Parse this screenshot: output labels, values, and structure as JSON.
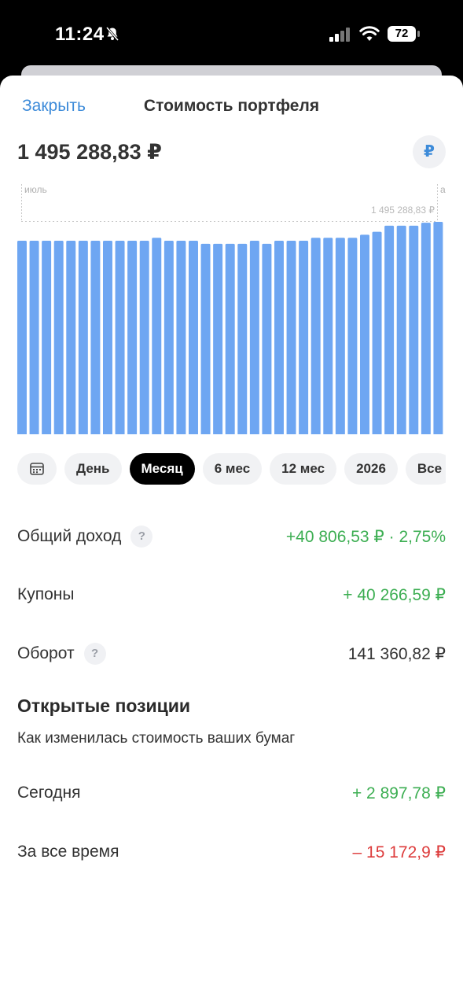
{
  "status_bar": {
    "time": "11:24",
    "battery": "72"
  },
  "header": {
    "close_label": "Закрыть",
    "title": "Стоимость портфеля"
  },
  "portfolio": {
    "total": "1 495 288,83 ₽",
    "currency_symbol": "₽"
  },
  "chart_data": {
    "type": "bar",
    "start_label": "июль",
    "end_label_partial": "а",
    "peak_label": "1 495 288,83 ₽",
    "bar_color": "#6ea6f2",
    "values": [
      1489,
      1489,
      1489,
      1489,
      1489,
      1489,
      1489,
      1489,
      1489,
      1489,
      1489,
      1490,
      1489,
      1489,
      1489,
      1488,
      1488,
      1488,
      1488,
      1489,
      1488,
      1489,
      1489,
      1489,
      1490,
      1490,
      1490,
      1490,
      1491,
      1492,
      1494,
      1494,
      1494,
      1495,
      1495.29
    ]
  },
  "periods": {
    "items": [
      {
        "label": "День",
        "active": false
      },
      {
        "label": "Месяц",
        "active": true
      },
      {
        "label": "6 мес",
        "active": false
      },
      {
        "label": "12 мес",
        "active": false
      },
      {
        "label": "2026",
        "active": false
      },
      {
        "label": "Все",
        "active": false
      }
    ]
  },
  "stats": {
    "total_income": {
      "label": "Общий доход",
      "help": "?",
      "value": "+40 806,53 ₽ · 2,75%"
    },
    "coupons": {
      "label": "Купоны",
      "value": "+ 40 266,59 ₽"
    },
    "turnover": {
      "label": "Оборот",
      "help": "?",
      "value": "141 360,82 ₽"
    }
  },
  "open_positions": {
    "title": "Открытые позиции",
    "subtitle": "Как изменилась стоимость ваших бумаг",
    "today": {
      "label": "Сегодня",
      "value": "+ 2 897,78 ₽"
    },
    "all_time": {
      "label": "За все время",
      "value": "– 15 172,9 ₽"
    }
  },
  "colors": {
    "accent": "#3d8bd9",
    "positive": "#3cae52",
    "negative": "#dd3b3b"
  }
}
